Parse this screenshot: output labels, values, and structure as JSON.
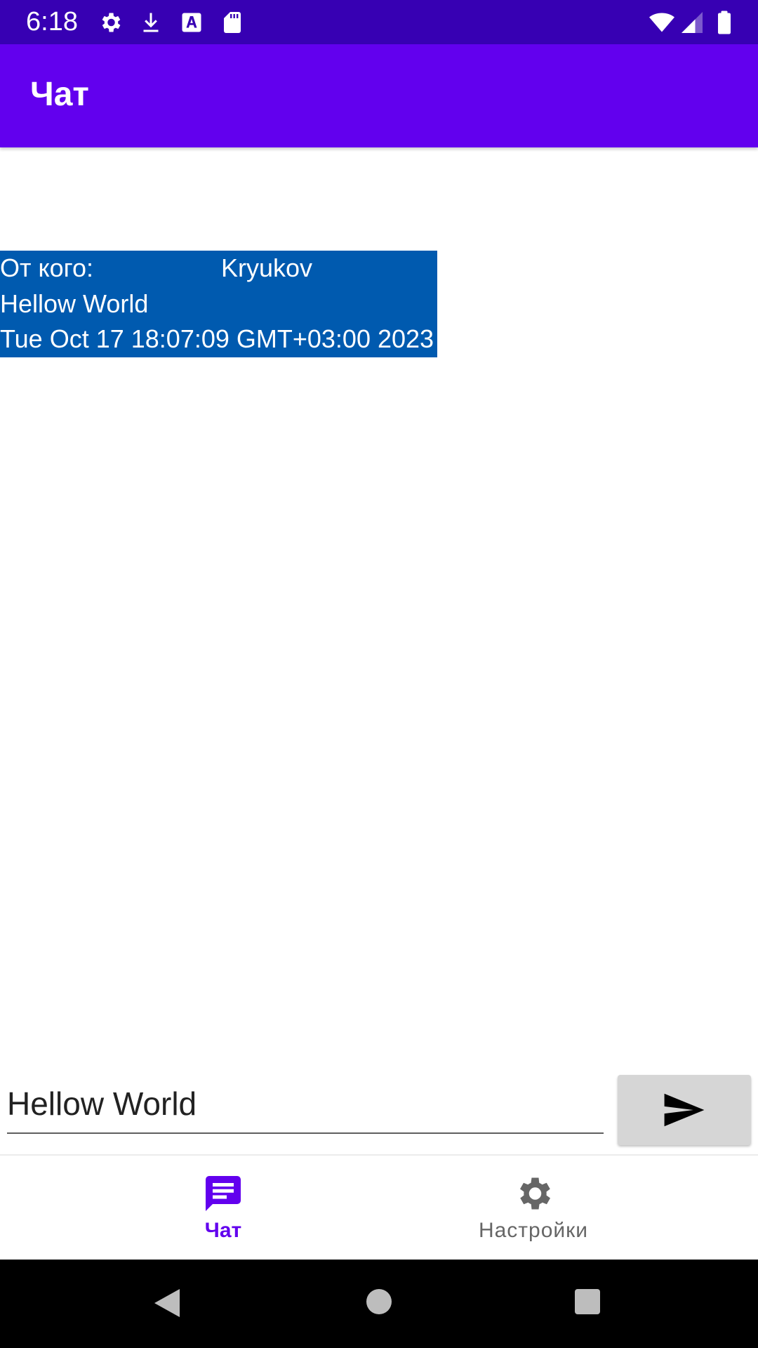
{
  "status_bar": {
    "time": "6:18",
    "icons": [
      "gear-icon",
      "download-icon",
      "font-a-icon",
      "sd-card-icon",
      "wifi-icon",
      "signal-icon",
      "battery-icon"
    ]
  },
  "app_bar": {
    "title": "Чат"
  },
  "messages": [
    {
      "from_label": "От кого:",
      "from_name": "Kryukov",
      "text": "Hellow World",
      "timestamp": "Tue Oct 17 18:07:09 GMT+03:00 2023"
    }
  ],
  "composer": {
    "input_value": "Hellow World",
    "send_icon": "send-icon"
  },
  "bottom_nav": {
    "items": [
      {
        "label": "Чат",
        "icon": "chat-icon",
        "active": true
      },
      {
        "label": "Настройки",
        "icon": "settings-gear-icon",
        "active": false
      }
    ]
  },
  "system_nav": {
    "icons": [
      "back-icon",
      "home-icon",
      "recents-icon"
    ]
  },
  "colors": {
    "status_bar": "#3700B3",
    "app_bar": "#6200EE",
    "message_bg": "#005AAF",
    "accent": "#6200EE",
    "send_button_bg": "#D6D6D6"
  }
}
